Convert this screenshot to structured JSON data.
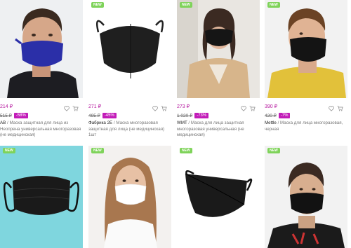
{
  "badge_label": "NEW",
  "products": [
    {
      "id": "p1",
      "price": "214 ₽",
      "old_price": "515 ₽",
      "discount": "-58%",
      "brand": "AB",
      "description": "Маска защитная для лица из Неопрена универсальная многоразовая (не медицинская)",
      "image": "man-blue-neoprene-mask",
      "new_badge": false
    },
    {
      "id": "p2",
      "price": "271 ₽",
      "old_price": "495 ₽",
      "discount": "-45%",
      "brand": "Фабрика 2Е",
      "description": "Маска многоразовая защитная для лица (не медицинская) 1шт",
      "image": "black-mask-product",
      "new_badge": true
    },
    {
      "id": "p3",
      "price": "273 ₽",
      "old_price": "1 020 ₽",
      "discount": "-73%",
      "brand": "WMT",
      "description": "Маска для лица защитная многоразовая универсальная (не медицинская)",
      "image": "woman-beige-coat-black-mask",
      "new_badge": true
    },
    {
      "id": "p4",
      "price": "390 ₽",
      "old_price": "420 ₽",
      "discount": "-7%",
      "brand": "Mettle",
      "description": "Маска для лица многоразовая, черная",
      "image": "boy-yellow-sweater-black-mask",
      "new_badge": true
    },
    {
      "id": "p5",
      "image": "black-mask-on-cyan",
      "new_badge": true
    },
    {
      "id": "p6",
      "image": "woman-white-mask",
      "new_badge": true
    },
    {
      "id": "p7",
      "image": "black-mask-product-2",
      "new_badge": true
    },
    {
      "id": "p8",
      "image": "boy-black-mask",
      "new_badge": true
    }
  ],
  "colors": {
    "price": "#b5179e",
    "discount_bg": "#c21cb8",
    "new_badge_bg": "#7fd35a"
  }
}
